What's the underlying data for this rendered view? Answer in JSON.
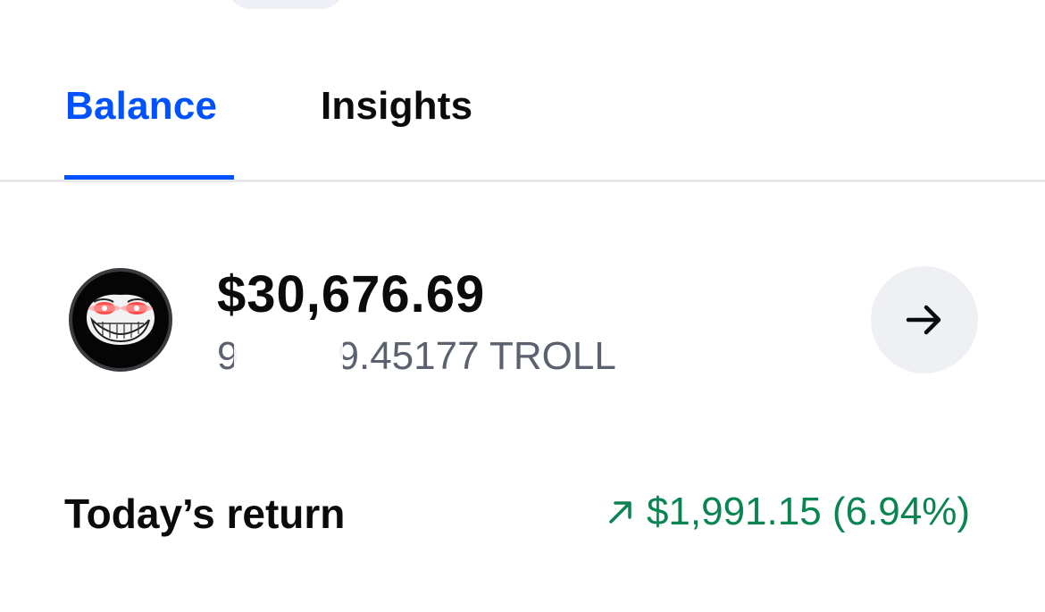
{
  "tabs": [
    {
      "label": "Balance",
      "active": true
    },
    {
      "label": "Insights",
      "active": false
    }
  ],
  "asset": {
    "fiat_value": "$30,676.69",
    "crypto_amount": "9         9.45177 TROLL",
    "icon": "troll-face-icon"
  },
  "today_return": {
    "label": "Today’s return",
    "value": "$1,991.15 (6.94%)",
    "direction": "up",
    "icon": "arrow-up-right-icon"
  },
  "colors": {
    "accent": "#0052ff",
    "positive": "#098551",
    "secondary_text": "#5b616e",
    "divider": "#e5e7eb"
  }
}
